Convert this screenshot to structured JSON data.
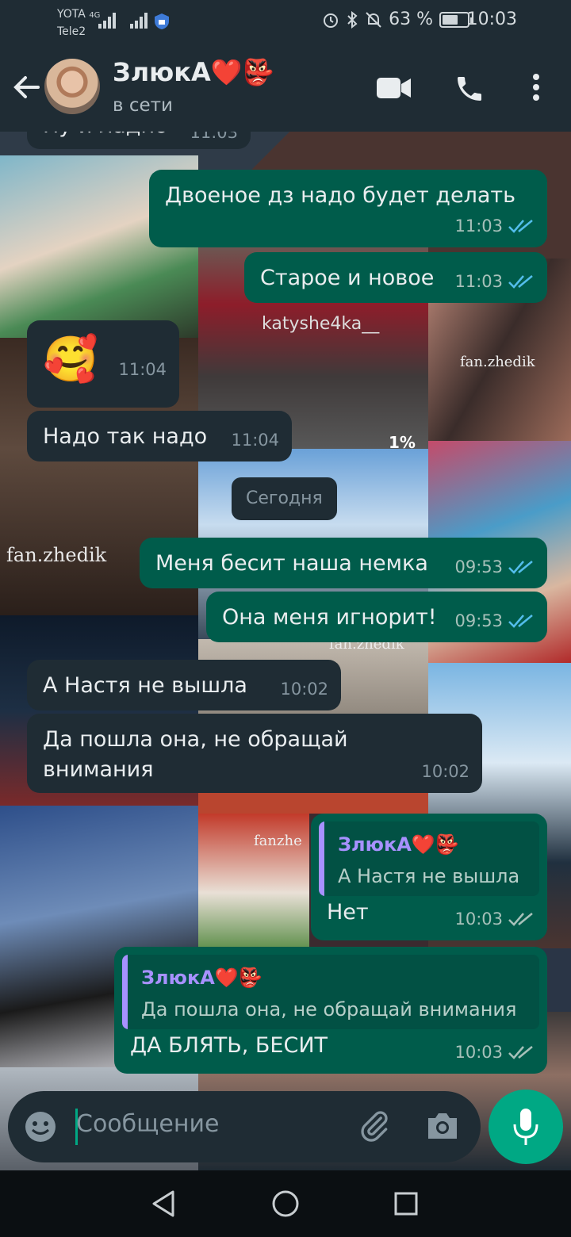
{
  "status_bar": {
    "carrier1": "YOTA",
    "carrier1_net": "4G",
    "carrier2": "Tele2",
    "battery": "63 %",
    "battery_level": 0.63,
    "time": "10:03"
  },
  "header": {
    "contact_name": "ЗлюкА❤️👺",
    "status": "в сети"
  },
  "messages": [
    {
      "dir": "in",
      "text": "Ну и ладно",
      "time": "11:03"
    },
    {
      "dir": "out",
      "text": "Двоеное дз надо будет делать",
      "time": "11:03"
    },
    {
      "dir": "out",
      "text": "Старое и новое",
      "time": "11:03"
    },
    {
      "dir": "in",
      "text": "🥰",
      "time": "11:04"
    },
    {
      "dir": "in",
      "text": "Надо так надо",
      "time": "11:04"
    },
    {
      "dir": "out",
      "text": "Меня бесит наша немка",
      "time": "09:53"
    },
    {
      "dir": "out",
      "text": "Она меня игнорит!",
      "time": "09:53"
    },
    {
      "dir": "in",
      "text": "А Настя не вышла",
      "time": "10:02"
    },
    {
      "dir": "in",
      "text": "Да пошла она, не обращай внимания",
      "time": "10:02"
    },
    {
      "dir": "out",
      "text": "Нет",
      "time": "10:03",
      "quote_name": "ЗлюкА❤️👺",
      "quote_text": "А Настя не вышла"
    },
    {
      "dir": "out",
      "text": "ДА БЛЯТЬ, БЕСИТ",
      "time": "10:03",
      "quote_name": "ЗлюкА❤️👺",
      "quote_text": "Да пошла она, не обращай внимания"
    }
  ],
  "day_separator": "Сегодня",
  "composer": {
    "placeholder": "Сообщение"
  },
  "wallpaper_watermarks": [
    "fan.zhedik",
    "fan.zhedik",
    "katyshe4ka__",
    "fan.zhedik",
    "fanzhe",
    "1%"
  ],
  "icons": [
    "back-arrow-icon",
    "video-call-icon",
    "phone-icon",
    "more-icon",
    "emoji-icon",
    "attach-icon",
    "camera-icon",
    "mic-icon",
    "double-check-icon",
    "nav-back-icon",
    "nav-home-icon",
    "nav-recents-icon",
    "alarm-icon",
    "bluetooth-icon",
    "mute-icon"
  ],
  "colors": {
    "accent": "#00a884",
    "outgoing": "#005c4b",
    "incoming": "#1f2c34",
    "quote_name": "#a791ff",
    "read_ticks": "#53bdeb"
  }
}
